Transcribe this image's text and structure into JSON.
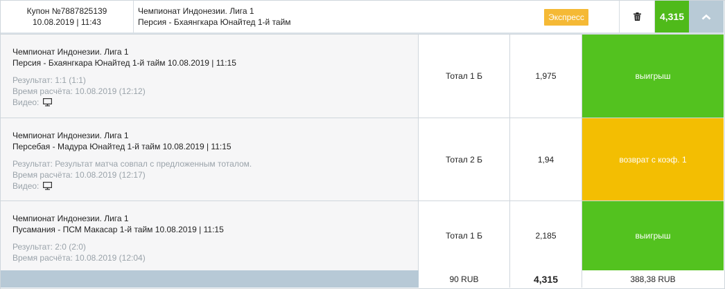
{
  "header": {
    "coupon_number": "Купон №7887825139",
    "coupon_datetime": "10.08.2019 | 11:43",
    "match_league": "Чемпионат Индонезии. Лига 1",
    "match_title": "Персия - Бхаянгкара Юнайтед 1-й тайм",
    "badge_label": "Экспресс",
    "total_odds": "4,315",
    "trash_icon": "trash-icon",
    "toggle_icon": "chevron-up-icon"
  },
  "colors": {
    "win": "#53c21f",
    "refund": "#f3be02",
    "badge": "#f5b935",
    "header_total": "#4fba1a",
    "footer_band": "#b7c9d6"
  },
  "bets": [
    {
      "league": "Чемпионат Индонезии. Лига 1",
      "match": "Персия - Бхаянгкара Юнайтед 1-й тайм 10.08.2019 | 11:15",
      "result": "Результат: 1:1 (1:1)",
      "settled": "Время расчёта: 10.08.2019 (12:12)",
      "video_label": "Видео:",
      "bet_type": "Тотал 1 Б",
      "odds": "1,975",
      "outcome": "выигрыш"
    },
    {
      "league": "Чемпионат Индонезии. Лига 1",
      "match": "Персебая - Мадура Юнайтед 1-й тайм 10.08.2019 | 11:15",
      "result": "Результат: Результат матча совпал с предложенным тоталом.",
      "settled": "Время расчёта: 10.08.2019 (12:17)",
      "video_label": "Видео:",
      "bet_type": "Тотал 2 Б",
      "odds": "1,94",
      "outcome": "возврат с коэф. 1"
    },
    {
      "league": "Чемпионат Индонезии. Лига 1",
      "match": "Пусамания - ПСМ Макасар 1-й тайм 10.08.2019 | 11:15",
      "result": "Результат: 2:0 (2:0)",
      "settled": "Время расчёта: 10.08.2019 (12:04)",
      "bet_type": "Тотал 1 Б",
      "odds": "2,185",
      "outcome": "выигрыш"
    }
  ],
  "footer": {
    "stake": "90 RUB",
    "total_odds": "4,315",
    "payout": "388,38 RUB"
  }
}
